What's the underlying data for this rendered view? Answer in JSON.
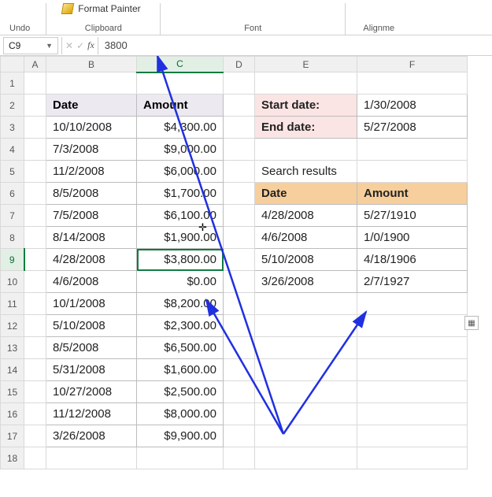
{
  "ribbon": {
    "undo_label": "Undo",
    "format_painter": "Format Painter",
    "clipboard_label": "Clipboard",
    "font_label": "Font",
    "alignment_label": "Alignme"
  },
  "namebox": {
    "ref": "C9"
  },
  "formula_bar": {
    "cancel": "✕",
    "confirm": "✓",
    "fx": "fx",
    "value": "3800"
  },
  "columns": [
    "A",
    "B",
    "C",
    "D",
    "E",
    "F"
  ],
  "rows": [
    "1",
    "2",
    "3",
    "4",
    "5",
    "6",
    "7",
    "8",
    "9",
    "10",
    "11",
    "12",
    "13",
    "14",
    "15",
    "16",
    "17",
    "18"
  ],
  "table_left": {
    "headers": {
      "date": "Date",
      "amount": "Amount"
    },
    "rows": [
      {
        "date": "10/10/2008",
        "amount": "$4,300.00"
      },
      {
        "date": "7/3/2008",
        "amount": "$9,000.00"
      },
      {
        "date": "11/2/2008",
        "amount": "$6,000.00"
      },
      {
        "date": "8/5/2008",
        "amount": "$1,700.00"
      },
      {
        "date": "7/5/2008",
        "amount": "$6,100.00"
      },
      {
        "date": "8/14/2008",
        "amount": "$1,900.00"
      },
      {
        "date": "4/28/2008",
        "amount": "$3,800.00"
      },
      {
        "date": "4/6/2008",
        "amount": "$0.00"
      },
      {
        "date": "10/1/2008",
        "amount": "$8,200.00"
      },
      {
        "date": "5/10/2008",
        "amount": "$2,300.00"
      },
      {
        "date": "8/5/2008",
        "amount": "$6,500.00"
      },
      {
        "date": "5/31/2008",
        "amount": "$1,600.00"
      },
      {
        "date": "10/27/2008",
        "amount": "$2,500.00"
      },
      {
        "date": "11/12/2008",
        "amount": "$8,000.00"
      },
      {
        "date": "3/26/2008",
        "amount": "$9,900.00"
      }
    ]
  },
  "params": {
    "start_label": "Start date:",
    "start_value": "1/30/2008",
    "end_label": "End date:",
    "end_value": "5/27/2008"
  },
  "results": {
    "title": "Search results",
    "headers": {
      "date": "Date",
      "amount": "Amount"
    },
    "rows": [
      {
        "date": "4/28/2008",
        "amount": "5/27/1910"
      },
      {
        "date": "4/6/2008",
        "amount": "1/0/1900"
      },
      {
        "date": "5/10/2008",
        "amount": "4/18/1906"
      },
      {
        "date": "3/26/2008",
        "amount": "2/7/1927"
      }
    ]
  },
  "selected": {
    "row": 9,
    "col": "C"
  }
}
